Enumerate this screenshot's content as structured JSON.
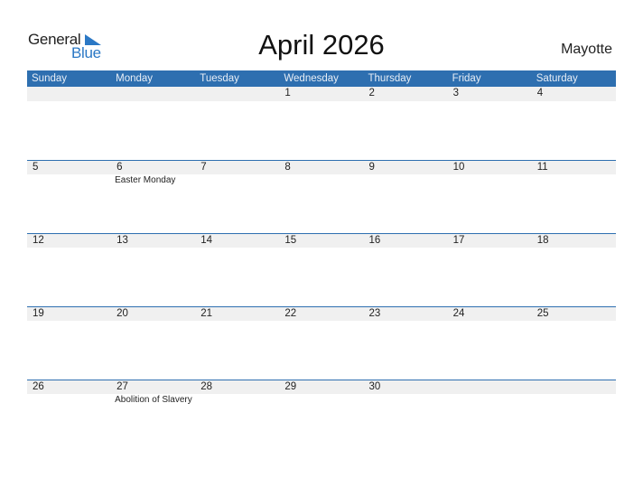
{
  "logo": {
    "general": "General",
    "blue": "Blue"
  },
  "title": "April 2026",
  "country": "Mayotte",
  "colors": {
    "accent": "#2e6fb0",
    "row_bg": "#f0f0f0"
  },
  "weekdays": [
    "Sunday",
    "Monday",
    "Tuesday",
    "Wednesday",
    "Thursday",
    "Friday",
    "Saturday"
  ],
  "weeks": [
    {
      "days": [
        "",
        "",
        "",
        "1",
        "2",
        "3",
        "4"
      ],
      "events": [
        "",
        "",
        "",
        "",
        "",
        "",
        ""
      ]
    },
    {
      "days": [
        "5",
        "6",
        "7",
        "8",
        "9",
        "10",
        "11"
      ],
      "events": [
        "",
        "Easter Monday",
        "",
        "",
        "",
        "",
        ""
      ]
    },
    {
      "days": [
        "12",
        "13",
        "14",
        "15",
        "16",
        "17",
        "18"
      ],
      "events": [
        "",
        "",
        "",
        "",
        "",
        "",
        ""
      ]
    },
    {
      "days": [
        "19",
        "20",
        "21",
        "22",
        "23",
        "24",
        "25"
      ],
      "events": [
        "",
        "",
        "",
        "",
        "",
        "",
        ""
      ]
    },
    {
      "days": [
        "26",
        "27",
        "28",
        "29",
        "30",
        "",
        ""
      ],
      "events": [
        "",
        "Abolition of Slavery",
        "",
        "",
        "",
        "",
        ""
      ]
    }
  ]
}
